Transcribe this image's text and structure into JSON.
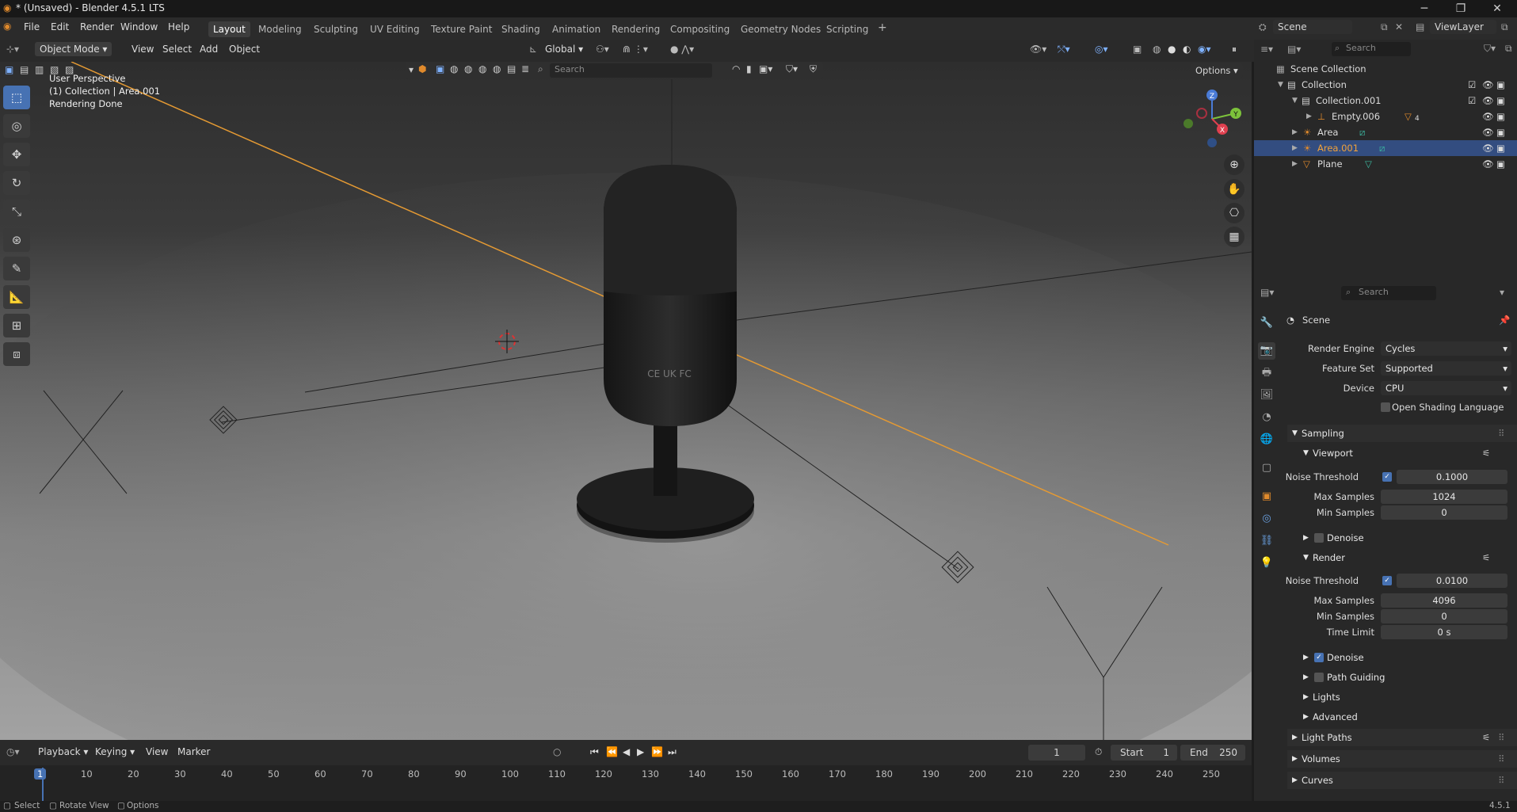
{
  "window": {
    "title": "* (Unsaved) - Blender 4.5.1 LTS",
    "minimize": "─",
    "maximize": "❐",
    "close": "✕"
  },
  "menu": [
    "File",
    "Edit",
    "Render",
    "Window",
    "Help"
  ],
  "workspaces": [
    "Layout",
    "Modeling",
    "Sculpting",
    "UV Editing",
    "Texture Paint",
    "Shading",
    "Animation",
    "Rendering",
    "Compositing",
    "Geometry Nodes",
    "Scripting"
  ],
  "workspace_add": "+",
  "scene": {
    "name": "Scene",
    "view_layer": "ViewLayer"
  },
  "viewport_header": {
    "mode": "Object Mode",
    "items": [
      "View",
      "Select",
      "Add",
      "Object"
    ],
    "transform": "Global",
    "options": "Options",
    "search_placeholder": "Search"
  },
  "viewport_overlay": {
    "line1": "User Perspective",
    "line2": "(1) Collection | Area.001",
    "line3": "Rendering Done"
  },
  "gizmo": {
    "x": "X",
    "y": "Y",
    "z": "Z"
  },
  "outliner": {
    "search_placeholder": "Search",
    "root": "Scene Collection",
    "rows": [
      {
        "label": "Collection",
        "icon": "collection-icon"
      },
      {
        "label": "Collection.001",
        "icon": "collection-icon"
      },
      {
        "label": "Empty.006",
        "icon": "empty-icon",
        "badge": "4"
      },
      {
        "label": "Area",
        "icon": "light-icon"
      },
      {
        "label": "Area.001",
        "icon": "light-icon"
      },
      {
        "label": "Plane",
        "icon": "mesh-icon"
      }
    ]
  },
  "properties": {
    "search_placeholder": "Search",
    "context": "Scene",
    "render_engine_label": "Render Engine",
    "render_engine": "Cycles",
    "feature_set_label": "Feature Set",
    "feature_set": "Supported",
    "device_label": "Device",
    "device": "CPU",
    "osl_label": "Open Shading Language",
    "sampling": "Sampling",
    "viewport": "Viewport",
    "noise_threshold_label": "Noise Threshold",
    "viewport_noise": "0.1000",
    "max_samples_label": "Max Samples",
    "viewport_max": "1024",
    "min_samples_label": "Min Samples",
    "viewport_min": "0",
    "denoise": "Denoise",
    "render": "Render",
    "render_noise": "0.0100",
    "render_max": "4096",
    "render_min": "0",
    "time_limit_label": "Time Limit",
    "time_limit": "0 s",
    "path_guiding": "Path Guiding",
    "lights": "Lights",
    "advanced": "Advanced",
    "light_paths": "Light Paths",
    "volumes": "Volumes",
    "curves": "Curves"
  },
  "timeline": {
    "menus": [
      "Playback",
      "Keying",
      "View",
      "Marker"
    ],
    "current_frame": "1",
    "start_label": "Start",
    "start": "1",
    "end_label": "End",
    "end": "250",
    "ticks": [
      "1",
      "10",
      "20",
      "30",
      "40",
      "50",
      "60",
      "70",
      "80",
      "90",
      "100",
      "110",
      "120",
      "130",
      "140",
      "150",
      "160",
      "170",
      "180",
      "190",
      "200",
      "210",
      "220",
      "230",
      "240",
      "250"
    ]
  },
  "status": {
    "select": "Select",
    "rotate": "Rotate View",
    "options": "Options",
    "version": "4.5.1"
  },
  "product_print": "CE UK FC"
}
